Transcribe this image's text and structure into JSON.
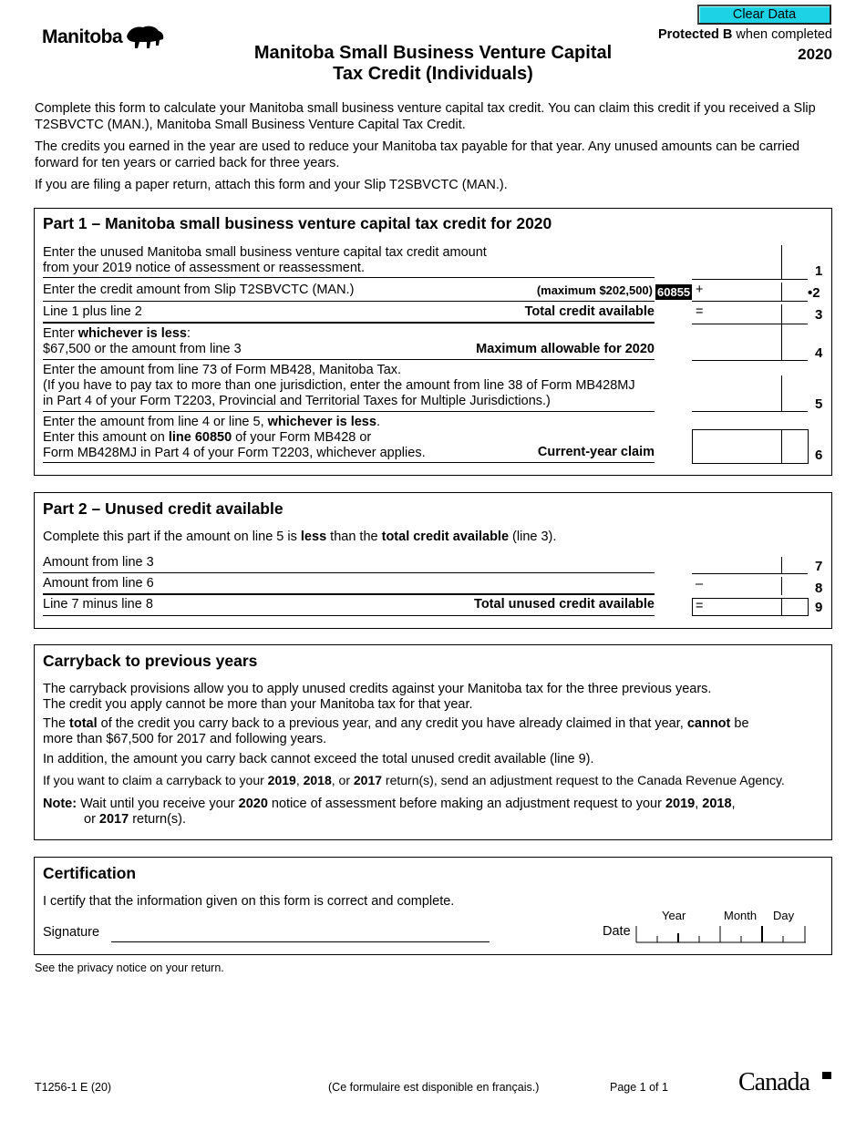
{
  "header": {
    "clear_button": "Clear Data",
    "protected_bold": "Protected B",
    "protected_rest": " when completed",
    "year": "2020",
    "logo_text": "Manitoba",
    "title_line1": "Manitoba Small Business Venture Capital",
    "title_line2": "Tax Credit (Individuals)"
  },
  "intro": {
    "p1": "Complete this form to calculate your Manitoba small business venture capital tax credit. You can claim this credit if you received a Slip T2SBVCTC (MAN.), Manitoba Small Business Venture Capital Tax Credit.",
    "p2": "The credits you earned in the year are used to reduce your Manitoba tax payable for that year. Any unused amounts can be carried forward for ten years or carried back for three years.",
    "p3": "If you are filing a paper return, attach this form and your Slip T2SBVCTC (MAN.)."
  },
  "part1": {
    "title": "Part 1 – Manitoba small business venture capital tax credit for 2020",
    "line1_a": "Enter the unused Manitoba small business venture capital tax credit amount",
    "line1_b": "from your 2019 notice of assessment or reassessment.",
    "line2_text": "Enter the credit amount from Slip T2SBVCTC (MAN.)",
    "line2_right": "(maximum $202,500)",
    "line2_code": "60855",
    "line2_op": "+",
    "line3_text": "Line 1 plus line 2",
    "line3_right": "Total credit available",
    "line3_op": "=",
    "line4_a_pre": "Enter ",
    "line4_a_bold": "whichever is less",
    "line4_a_post": ":",
    "line4_b": "$67,500 or the amount from line 3",
    "line4_right": "Maximum allowable for 2020",
    "line5_a": "Enter the amount from line 73 of Form MB428, Manitoba Tax.",
    "line5_b": "(If you have to pay tax to more than one jurisdiction, enter the amount from line 38 of Form MB428MJ",
    "line5_c": "in Part 4 of your Form T2203, Provincial and Territorial Taxes for Multiple Jurisdictions.)",
    "line6_a_pre": "Enter the amount from line 4 or line 5, ",
    "line6_a_bold": "whichever is less",
    "line6_a_post": ".",
    "line6_b_pre": "Enter this amount on ",
    "line6_b_bold": "line 60850",
    "line6_b_post": " of your Form MB428 or",
    "line6_c": "Form MB428MJ in Part 4 of your Form T2203, whichever applies.",
    "line6_right": "Current-year claim",
    "line_numbers": [
      "1",
      "•2",
      "3",
      "4",
      "5",
      "6"
    ]
  },
  "part2": {
    "title": "Part 2 – Unused credit available",
    "desc_pre": "Complete this part if the amount on line 5 is ",
    "desc_b1": "less",
    "desc_mid": " than the ",
    "desc_b2": "total credit available",
    "desc_post": " (line 3).",
    "line7_text": "Amount from line 3",
    "line8_text": "Amount from line 6",
    "line8_op": "–",
    "line9_text": "Line 7 minus line 8",
    "line9_right": "Total unused credit available",
    "line9_op": "=",
    "line_numbers": [
      "7",
      "8",
      "9"
    ]
  },
  "carryback": {
    "title": "Carryback to previous years",
    "p1a": "The carryback provisions allow you to apply unused credits against your Manitoba tax for the three previous years.",
    "p1b": "The credit you apply cannot be more than your Manitoba tax for that year.",
    "p2_pre": "The ",
    "p2_b1": "total",
    "p2_mid": " of the credit you carry back to a previous year, and any credit you have already claimed in that year, ",
    "p2_b2": "cannot",
    "p2_post": " be",
    "p2_line2": "more than $67,500 for 2017 and following years.",
    "p3": "In addition, the amount you carry back cannot exceed the total unused credit available (line 9).",
    "p4_pre": "If you want to claim a carryback to your ",
    "p4_y1": "2019",
    "p4_c1": ", ",
    "p4_y2": "2018",
    "p4_c2": ", or ",
    "p4_y3": "2017",
    "p4_post": " return(s), send an adjustment request to the Canada Revenue Agency.",
    "note_label": "Note:",
    "note_pre": " Wait until you receive your ",
    "note_y0": "2020",
    "note_mid": " notice of assessment before making an adjustment request to your ",
    "note_y1": "2019",
    "note_c1": ", ",
    "note_y2": "2018",
    "note_c2": ",",
    "note_l2_pre": "or ",
    "note_y3": "2017",
    "note_l2_post": " return(s)."
  },
  "certification": {
    "title": "Certification",
    "statement": "I certify that the information given on this form is correct and complete.",
    "signature_label": "Signature",
    "date_label": "Date",
    "year_label": "Year",
    "month_label": "Month",
    "day_label": "Day"
  },
  "privacy": "See the privacy notice on your return.",
  "footer": {
    "form_id": "T1256-1 E (20)",
    "french": "(Ce formulaire est disponible en français.)",
    "page": "Page 1 of 1",
    "canada": "Canada"
  }
}
